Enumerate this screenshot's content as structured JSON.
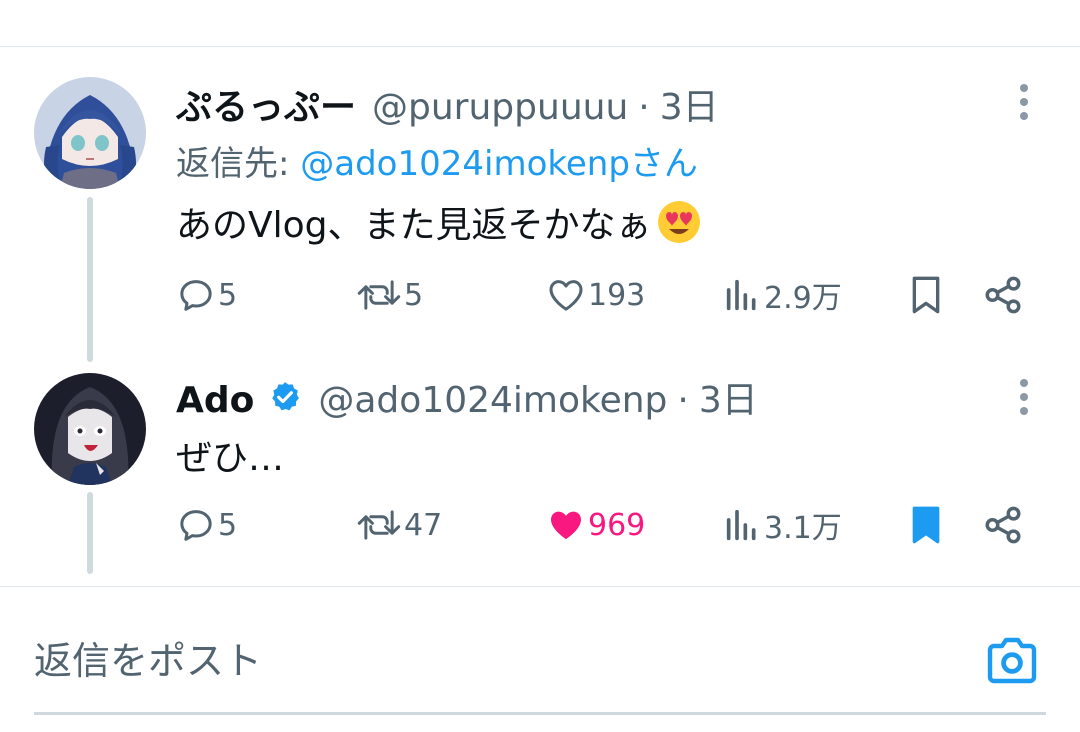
{
  "tweets": [
    {
      "name": "ぷるっぷー",
      "handle": "@puruppuuuu",
      "separator": "·",
      "time": "3日",
      "reply_prefix": "返信先: ",
      "reply_mention": "@ado1024imokenpさん",
      "text": "あのVlog、また見返そかなぁ",
      "emoji": "smiling-face-with-heart-eyes-emoji",
      "verified": false,
      "stats": {
        "replies": "5",
        "retweets": "5",
        "likes": "193",
        "views": "2.9万"
      },
      "liked": false,
      "bookmarked": false
    },
    {
      "name": "Ado",
      "handle": "@ado1024imokenp",
      "separator": "·",
      "time": "3日",
      "text": "ぜひ…",
      "verified": true,
      "stats": {
        "replies": "5",
        "retweets": "47",
        "likes": "969",
        "views": "3.1万"
      },
      "liked": true,
      "bookmarked": true
    }
  ],
  "composer": {
    "placeholder": "返信をポスト",
    "icon": "camera-icon"
  },
  "colors": {
    "accent": "#1d9bf0",
    "like": "#f91880",
    "muted": "#536471",
    "text": "#0f1419"
  }
}
